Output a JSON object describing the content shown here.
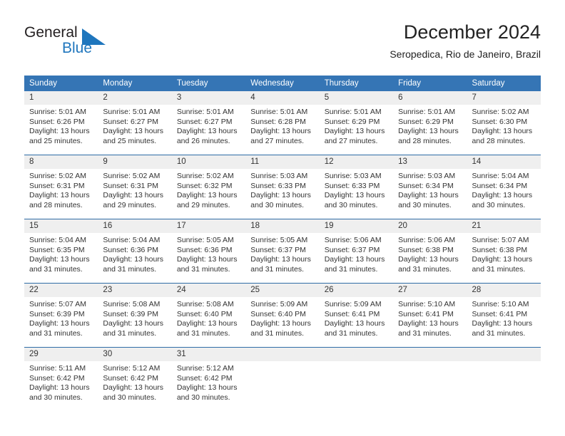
{
  "brand": {
    "name_part1": "General",
    "name_part2": "Blue",
    "triangle_icon": "triangle-icon",
    "color_dark": "#231f20",
    "color_blue": "#1f76bd"
  },
  "header": {
    "title": "December 2024",
    "subtitle": "Seropedica, Rio de Janeiro, Brazil"
  },
  "theme": {
    "header_bg": "#3575b5",
    "header_text": "#ffffff",
    "daynum_bg": "#efefef",
    "row_border": "#2f6ca6",
    "body_text": "#333333"
  },
  "calendar": {
    "weekday_headers": [
      "Sunday",
      "Monday",
      "Tuesday",
      "Wednesday",
      "Thursday",
      "Friday",
      "Saturday"
    ],
    "weeks": [
      [
        {
          "day": "1",
          "sunrise": "Sunrise: 5:01 AM",
          "sunset": "Sunset: 6:26 PM",
          "daylight_line1": "Daylight: 13 hours",
          "daylight_line2": "and 25 minutes."
        },
        {
          "day": "2",
          "sunrise": "Sunrise: 5:01 AM",
          "sunset": "Sunset: 6:27 PM",
          "daylight_line1": "Daylight: 13 hours",
          "daylight_line2": "and 25 minutes."
        },
        {
          "day": "3",
          "sunrise": "Sunrise: 5:01 AM",
          "sunset": "Sunset: 6:27 PM",
          "daylight_line1": "Daylight: 13 hours",
          "daylight_line2": "and 26 minutes."
        },
        {
          "day": "4",
          "sunrise": "Sunrise: 5:01 AM",
          "sunset": "Sunset: 6:28 PM",
          "daylight_line1": "Daylight: 13 hours",
          "daylight_line2": "and 27 minutes."
        },
        {
          "day": "5",
          "sunrise": "Sunrise: 5:01 AM",
          "sunset": "Sunset: 6:29 PM",
          "daylight_line1": "Daylight: 13 hours",
          "daylight_line2": "and 27 minutes."
        },
        {
          "day": "6",
          "sunrise": "Sunrise: 5:01 AM",
          "sunset": "Sunset: 6:29 PM",
          "daylight_line1": "Daylight: 13 hours",
          "daylight_line2": "and 28 minutes."
        },
        {
          "day": "7",
          "sunrise": "Sunrise: 5:02 AM",
          "sunset": "Sunset: 6:30 PM",
          "daylight_line1": "Daylight: 13 hours",
          "daylight_line2": "and 28 minutes."
        }
      ],
      [
        {
          "day": "8",
          "sunrise": "Sunrise: 5:02 AM",
          "sunset": "Sunset: 6:31 PM",
          "daylight_line1": "Daylight: 13 hours",
          "daylight_line2": "and 28 minutes."
        },
        {
          "day": "9",
          "sunrise": "Sunrise: 5:02 AM",
          "sunset": "Sunset: 6:31 PM",
          "daylight_line1": "Daylight: 13 hours",
          "daylight_line2": "and 29 minutes."
        },
        {
          "day": "10",
          "sunrise": "Sunrise: 5:02 AM",
          "sunset": "Sunset: 6:32 PM",
          "daylight_line1": "Daylight: 13 hours",
          "daylight_line2": "and 29 minutes."
        },
        {
          "day": "11",
          "sunrise": "Sunrise: 5:03 AM",
          "sunset": "Sunset: 6:33 PM",
          "daylight_line1": "Daylight: 13 hours",
          "daylight_line2": "and 30 minutes."
        },
        {
          "day": "12",
          "sunrise": "Sunrise: 5:03 AM",
          "sunset": "Sunset: 6:33 PM",
          "daylight_line1": "Daylight: 13 hours",
          "daylight_line2": "and 30 minutes."
        },
        {
          "day": "13",
          "sunrise": "Sunrise: 5:03 AM",
          "sunset": "Sunset: 6:34 PM",
          "daylight_line1": "Daylight: 13 hours",
          "daylight_line2": "and 30 minutes."
        },
        {
          "day": "14",
          "sunrise": "Sunrise: 5:04 AM",
          "sunset": "Sunset: 6:34 PM",
          "daylight_line1": "Daylight: 13 hours",
          "daylight_line2": "and 30 minutes."
        }
      ],
      [
        {
          "day": "15",
          "sunrise": "Sunrise: 5:04 AM",
          "sunset": "Sunset: 6:35 PM",
          "daylight_line1": "Daylight: 13 hours",
          "daylight_line2": "and 31 minutes."
        },
        {
          "day": "16",
          "sunrise": "Sunrise: 5:04 AM",
          "sunset": "Sunset: 6:36 PM",
          "daylight_line1": "Daylight: 13 hours",
          "daylight_line2": "and 31 minutes."
        },
        {
          "day": "17",
          "sunrise": "Sunrise: 5:05 AM",
          "sunset": "Sunset: 6:36 PM",
          "daylight_line1": "Daylight: 13 hours",
          "daylight_line2": "and 31 minutes."
        },
        {
          "day": "18",
          "sunrise": "Sunrise: 5:05 AM",
          "sunset": "Sunset: 6:37 PM",
          "daylight_line1": "Daylight: 13 hours",
          "daylight_line2": "and 31 minutes."
        },
        {
          "day": "19",
          "sunrise": "Sunrise: 5:06 AM",
          "sunset": "Sunset: 6:37 PM",
          "daylight_line1": "Daylight: 13 hours",
          "daylight_line2": "and 31 minutes."
        },
        {
          "day": "20",
          "sunrise": "Sunrise: 5:06 AM",
          "sunset": "Sunset: 6:38 PM",
          "daylight_line1": "Daylight: 13 hours",
          "daylight_line2": "and 31 minutes."
        },
        {
          "day": "21",
          "sunrise": "Sunrise: 5:07 AM",
          "sunset": "Sunset: 6:38 PM",
          "daylight_line1": "Daylight: 13 hours",
          "daylight_line2": "and 31 minutes."
        }
      ],
      [
        {
          "day": "22",
          "sunrise": "Sunrise: 5:07 AM",
          "sunset": "Sunset: 6:39 PM",
          "daylight_line1": "Daylight: 13 hours",
          "daylight_line2": "and 31 minutes."
        },
        {
          "day": "23",
          "sunrise": "Sunrise: 5:08 AM",
          "sunset": "Sunset: 6:39 PM",
          "daylight_line1": "Daylight: 13 hours",
          "daylight_line2": "and 31 minutes."
        },
        {
          "day": "24",
          "sunrise": "Sunrise: 5:08 AM",
          "sunset": "Sunset: 6:40 PM",
          "daylight_line1": "Daylight: 13 hours",
          "daylight_line2": "and 31 minutes."
        },
        {
          "day": "25",
          "sunrise": "Sunrise: 5:09 AM",
          "sunset": "Sunset: 6:40 PM",
          "daylight_line1": "Daylight: 13 hours",
          "daylight_line2": "and 31 minutes."
        },
        {
          "day": "26",
          "sunrise": "Sunrise: 5:09 AM",
          "sunset": "Sunset: 6:41 PM",
          "daylight_line1": "Daylight: 13 hours",
          "daylight_line2": "and 31 minutes."
        },
        {
          "day": "27",
          "sunrise": "Sunrise: 5:10 AM",
          "sunset": "Sunset: 6:41 PM",
          "daylight_line1": "Daylight: 13 hours",
          "daylight_line2": "and 31 minutes."
        },
        {
          "day": "28",
          "sunrise": "Sunrise: 5:10 AM",
          "sunset": "Sunset: 6:41 PM",
          "daylight_line1": "Daylight: 13 hours",
          "daylight_line2": "and 31 minutes."
        }
      ],
      [
        {
          "day": "29",
          "sunrise": "Sunrise: 5:11 AM",
          "sunset": "Sunset: 6:42 PM",
          "daylight_line1": "Daylight: 13 hours",
          "daylight_line2": "and 30 minutes."
        },
        {
          "day": "30",
          "sunrise": "Sunrise: 5:12 AM",
          "sunset": "Sunset: 6:42 PM",
          "daylight_line1": "Daylight: 13 hours",
          "daylight_line2": "and 30 minutes."
        },
        {
          "day": "31",
          "sunrise": "Sunrise: 5:12 AM",
          "sunset": "Sunset: 6:42 PM",
          "daylight_line1": "Daylight: 13 hours",
          "daylight_line2": "and 30 minutes."
        },
        {
          "day": "",
          "sunrise": "",
          "sunset": "",
          "daylight_line1": "",
          "daylight_line2": ""
        },
        {
          "day": "",
          "sunrise": "",
          "sunset": "",
          "daylight_line1": "",
          "daylight_line2": ""
        },
        {
          "day": "",
          "sunrise": "",
          "sunset": "",
          "daylight_line1": "",
          "daylight_line2": ""
        },
        {
          "day": "",
          "sunrise": "",
          "sunset": "",
          "daylight_line1": "",
          "daylight_line2": ""
        }
      ]
    ]
  }
}
